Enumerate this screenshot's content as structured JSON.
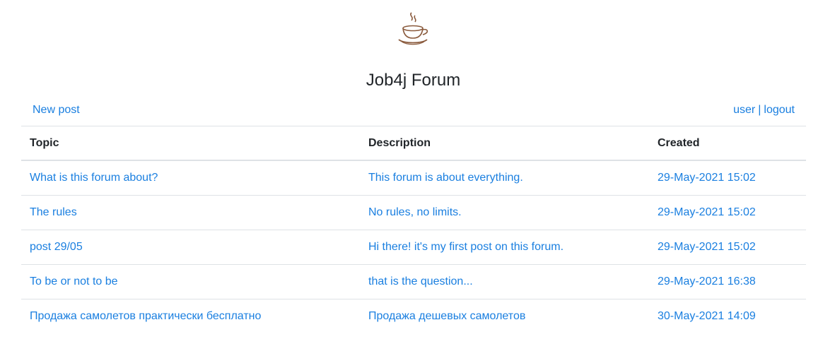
{
  "header": {
    "logo_icon": "coffee-cup-icon",
    "title": "Job4j Forum"
  },
  "nav": {
    "new_post": "New post",
    "user": "user",
    "separator": "|",
    "logout": "logout"
  },
  "table": {
    "columns": [
      "Topic",
      "Description",
      "Created"
    ],
    "rows": [
      {
        "topic": "What is this forum about?",
        "description": "This forum is about everything.",
        "created": "29-May-2021 15:02"
      },
      {
        "topic": "The rules",
        "description": "No rules, no limits.",
        "created": "29-May-2021 15:02"
      },
      {
        "topic": "post 29/05",
        "description": "Hi there! it's my first post on this forum.",
        "created": "29-May-2021 15:02"
      },
      {
        "topic": "To be or not to be",
        "description": "that is the question...",
        "created": "29-May-2021 16:38"
      },
      {
        "topic": "Продажа самолетов практически бесплатно",
        "description": "Продажа дешевых самолетов",
        "created": "30-May-2021 14:09"
      }
    ]
  },
  "colors": {
    "link": "#1a7fe0",
    "text": "#212529",
    "border": "#dee2e6",
    "logo": "#8a5a3c"
  }
}
